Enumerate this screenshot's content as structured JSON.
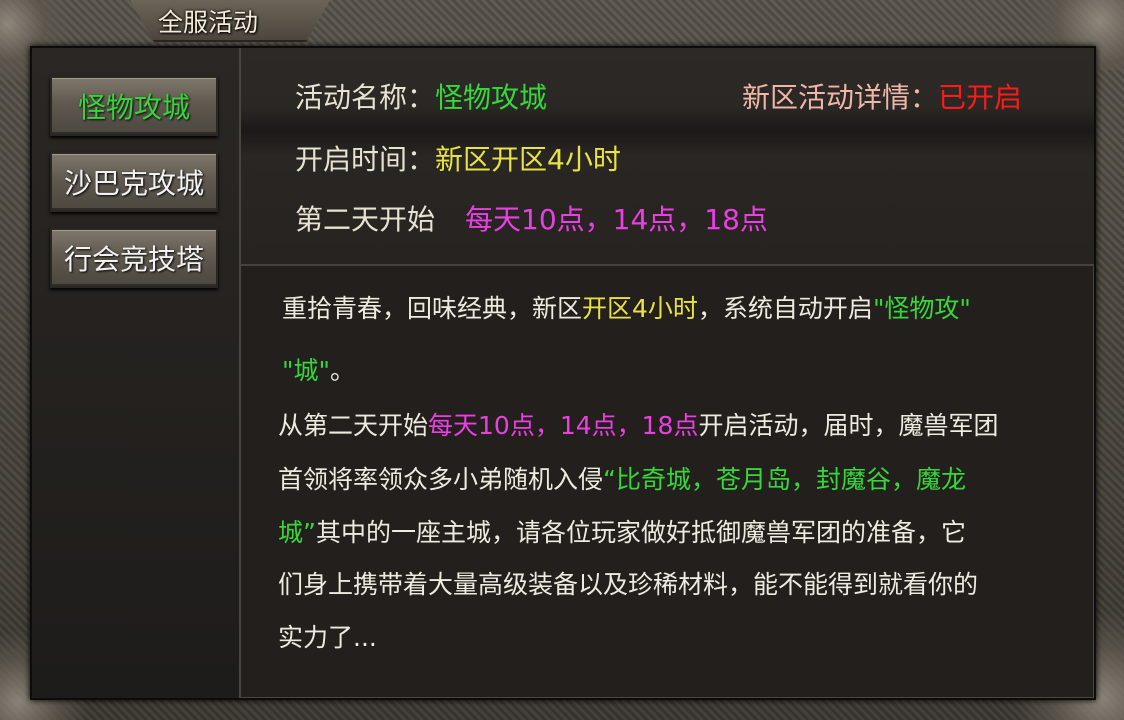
{
  "window": {
    "title": "全服活动"
  },
  "sidebar": {
    "items": [
      {
        "label": "怪物攻城",
        "active": true
      },
      {
        "label": "沙巴克攻城",
        "active": false
      },
      {
        "label": "行会竞技塔",
        "active": false
      }
    ]
  },
  "header": {
    "name_label": "活动名称：",
    "name_value": "怪物攻城",
    "detail_label": "新区活动详情：",
    "detail_value": "已开启",
    "time_label": "开启时间：",
    "time_value": "新区开区4小时",
    "day2_label": "第二天开始",
    "day2_value": "每天10点，14点，18点"
  },
  "description": {
    "l1_a": "重拾青春，回味经典，新区",
    "l1_b": "开区4小时",
    "l1_c": "，系统自动开启",
    "l1_d": "\"怪物攻\"",
    "l2_a": "\"城\"",
    "l2_b": "。",
    "l3_a": "从第二天开始",
    "l3_b": "每天10点，14点，18点",
    "l3_c": "开启活动，届时，魔兽军团",
    "l4_a": "首领将率领众多小弟随机入侵",
    "l4_b": "“比奇城，苍月岛，封魔谷，魔龙",
    "l5_a": "城”",
    "l5_b": "其中的一座主城，请各位玩家做好抵御魔兽军团的准备，它",
    "l6": "们身上携带着大量高级装备以及珍稀材料，能不能得到就看你的",
    "l7": "实力了..."
  },
  "colors": {
    "highlight_green": "#36d73a",
    "highlight_yellow": "#e9e243",
    "highlight_magenta": "#ea3fe4",
    "status_red": "#ff1a1a",
    "detail_pink": "#f0b7a9"
  }
}
